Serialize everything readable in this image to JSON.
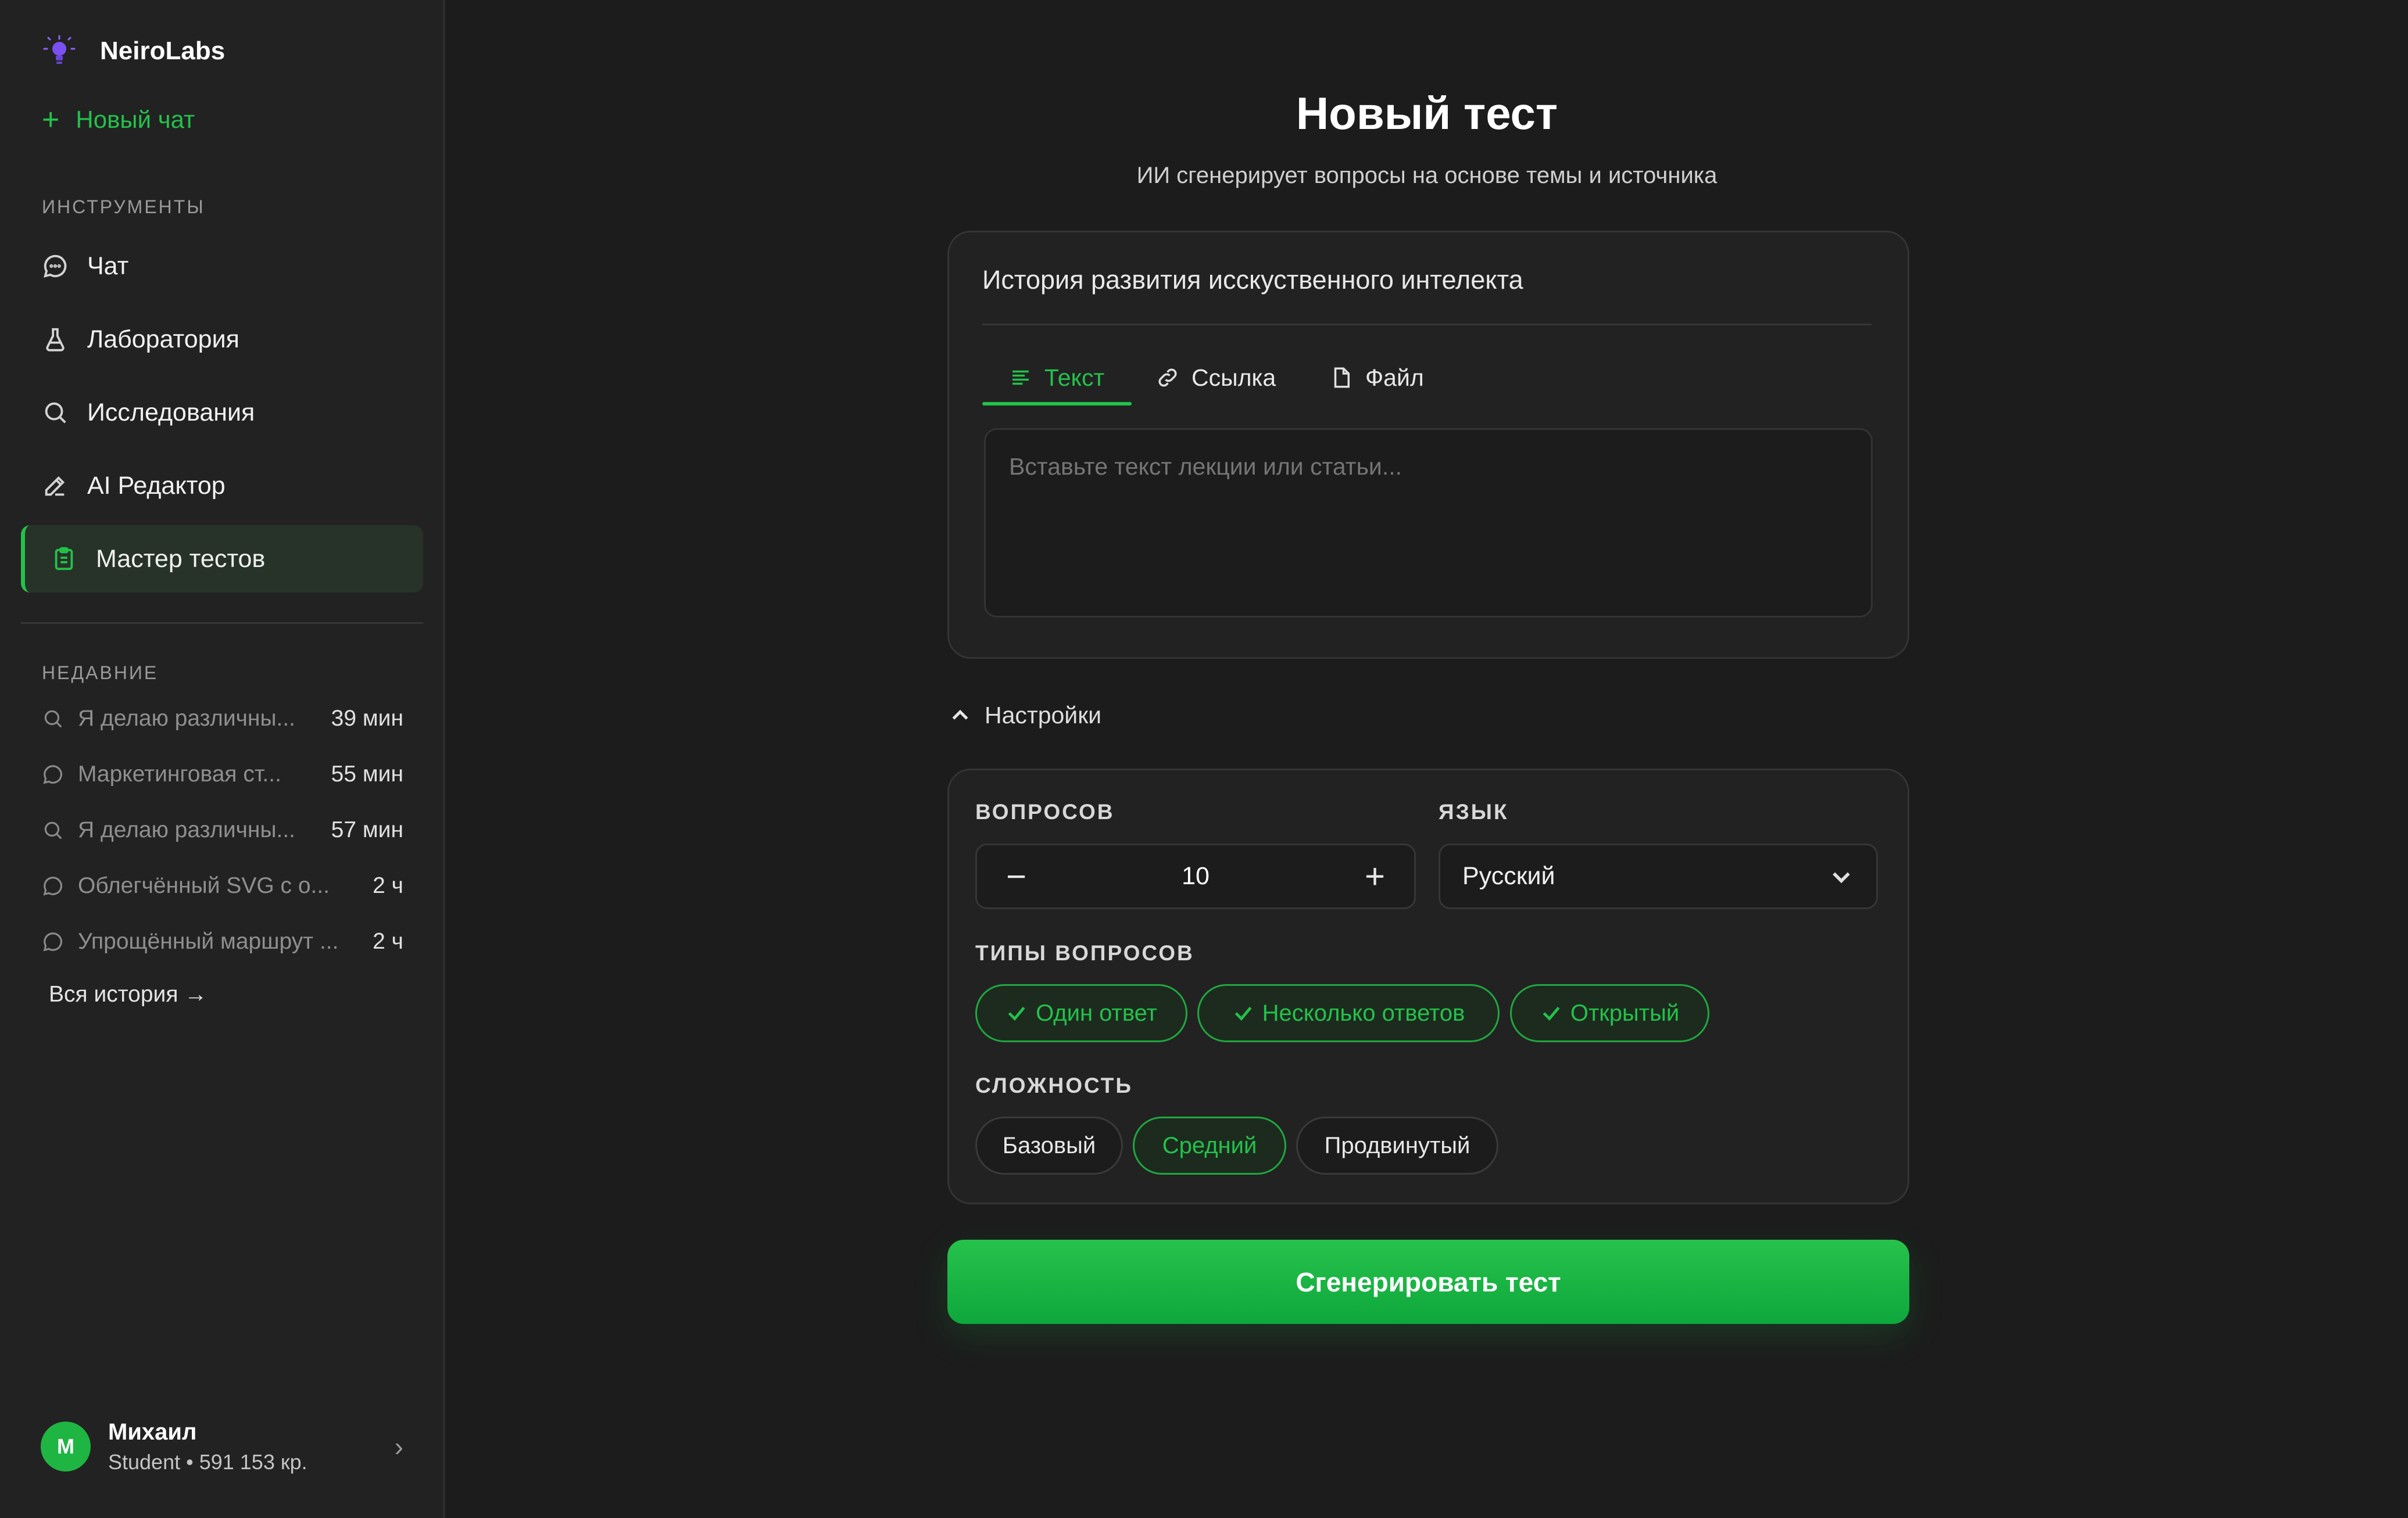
{
  "app": {
    "name": "NeiroLabs"
  },
  "sidebar": {
    "new_chat": "Новый чат",
    "tools_label": "Инструменты",
    "tools": [
      {
        "label": "Чат",
        "icon": "chat-bubble-icon"
      },
      {
        "label": "Лаборатория",
        "icon": "flask-icon"
      },
      {
        "label": "Исследования",
        "icon": "search-icon"
      },
      {
        "label": "AI Редактор",
        "icon": "pencil-icon"
      },
      {
        "label": "Мастер тестов",
        "icon": "clipboard-icon",
        "active": true
      }
    ],
    "recent_label": "Недавние",
    "recent": [
      {
        "title": "Я делаю различны...",
        "time": "39 мин",
        "icon": "search-icon"
      },
      {
        "title": "Маркетинговая ст...",
        "time": "55 мин",
        "icon": "chat-bubble-icon"
      },
      {
        "title": "Я делаю различны...",
        "time": "57 мин",
        "icon": "search-icon"
      },
      {
        "title": "Облегчённый SVG с о...",
        "time": "2 ч",
        "icon": "chat-bubble-icon"
      },
      {
        "title": "Упрощённый маршрут ...",
        "time": "2 ч",
        "icon": "chat-bubble-icon"
      }
    ],
    "all_history": "Вся история →"
  },
  "user": {
    "initial": "М",
    "name": "Михаил",
    "meta": "Student • 591 153 кр."
  },
  "main": {
    "title": "Новый тест",
    "subtitle": "ИИ сгенерирует вопросы на основе темы и источника",
    "topic_value": "История развития исскуственного интелекта",
    "tabs": [
      {
        "label": "Текст",
        "icon": "text-lines-icon",
        "active": true
      },
      {
        "label": "Ссылка",
        "icon": "link-icon"
      },
      {
        "label": "Файл",
        "icon": "file-icon"
      }
    ],
    "source_placeholder": "Вставьте текст лекции или статьи...",
    "settings_label": "Настройки",
    "questions_label": "Вопросов",
    "questions_count": "10",
    "stepper_minus": "−",
    "stepper_plus": "+",
    "language_label": "Язык",
    "language_value": "Русский",
    "types_label": "Типы вопросов",
    "types": [
      {
        "label": "Один ответ",
        "selected": true
      },
      {
        "label": "Несколько ответов",
        "selected": true
      },
      {
        "label": "Открытый",
        "selected": true
      }
    ],
    "difficulty_label": "Сложность",
    "difficulty": [
      {
        "label": "Базовый",
        "selected": false
      },
      {
        "label": "Средний",
        "selected": true
      },
      {
        "label": "Продвинутый",
        "selected": false
      }
    ],
    "generate_button": "Сгенерировать тест"
  },
  "colors": {
    "accent": "#23c24a",
    "background": "#1c1c1c",
    "sidebar": "#222222"
  }
}
